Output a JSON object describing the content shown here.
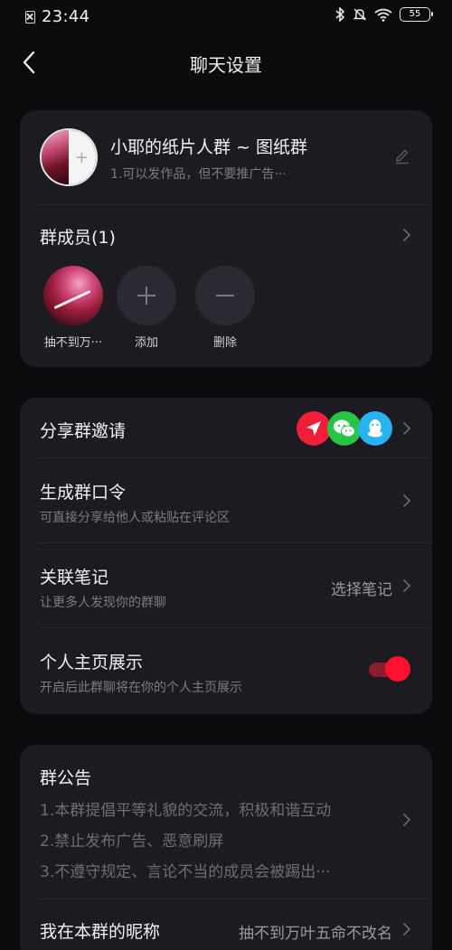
{
  "status_bar": {
    "time": "23:44",
    "battery": "55",
    "icons": [
      "sim-off-icon",
      "bluetooth-icon",
      "mute-icon",
      "wifi-icon",
      "battery-icon"
    ]
  },
  "nav": {
    "title": "聊天设置",
    "back_icon": "chevron-left-icon"
  },
  "group": {
    "name": "小耶的纸片人群 ~ 图纸群",
    "description": "1.可以发作品，但不要推广告···"
  },
  "members": {
    "title": "群成员(1)",
    "items": [
      {
        "label": "抽不到万···"
      },
      {
        "label": "添加"
      },
      {
        "label": "删除"
      }
    ]
  },
  "settings": {
    "share": {
      "title": "分享群邀请",
      "icons": [
        "share-red-icon",
        "wechat-icon",
        "qq-icon"
      ]
    },
    "password": {
      "title": "生成群口令",
      "subtitle": "可直接分享给他人或粘贴在评论区"
    },
    "note": {
      "title": "关联笔记",
      "subtitle": "让更多人发现你的群聊",
      "value": "选择笔记"
    },
    "profile": {
      "title": "个人主页展示",
      "subtitle": "开启后此群聊将在你的个人主页展示",
      "enabled": true
    }
  },
  "announcement": {
    "title": "群公告",
    "lines": [
      "1.本群提倡平等礼貌的交流，积极和谐互动",
      "2.禁止发布广告、恶意刷屏",
      "3.不遵守规定、言论不当的成员会被踢出···"
    ]
  },
  "nickname": {
    "title": "我在本群的昵称",
    "value": "抽不到万叶五命不改名"
  },
  "colors": {
    "background": "#0b0a0d",
    "card": "#1d1b22",
    "accent": "#ff1230",
    "muted_text": "#7d7b82"
  }
}
